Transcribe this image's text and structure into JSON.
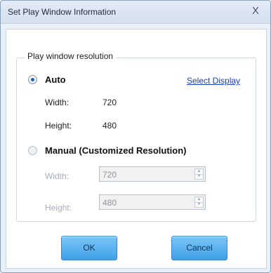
{
  "window": {
    "title": "Set Play Window Information",
    "close_glyph": "X"
  },
  "group": {
    "legend": "Play window resolution"
  },
  "auto": {
    "label": "Auto",
    "selected": true,
    "select_display_link": "Select Display",
    "width_label": "Width:",
    "width_value": "720",
    "height_label": "Height:",
    "height_value": "480"
  },
  "manual": {
    "label": "Manual (Customized Resolution)",
    "selected": false,
    "width_label": "Width:",
    "width_value": "720",
    "height_label": "Height:",
    "height_value": "480"
  },
  "buttons": {
    "ok": "OK",
    "cancel": "Cancel"
  },
  "icons": {
    "close": "close-icon",
    "spin_up": "chevron-up-icon",
    "spin_down": "chevron-down-icon"
  },
  "colors": {
    "accent": "#3ea0e8",
    "link": "#1840c0"
  }
}
